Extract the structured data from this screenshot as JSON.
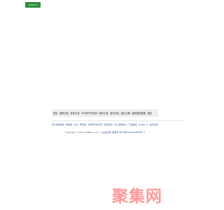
{
  "header": {
    "logo_text": "SkiBarns"
  },
  "nav": {
    "items": [
      "首页",
      "推荐出售",
      "新车出售",
      "中华网汽车资讯",
      "新车出售",
      "新车出售",
      "最近主题",
      "最新搭档搜集",
      "更多"
    ]
  },
  "links": {
    "items": [
      "导入其他域名 ",
      "精选站",
      "中心",
      "聚合站",
      "中华网汽车资讯",
      "聚合出售",
      "导入其他中心",
      "产品信息",
      "SkiBarns",
      "站点出售"
    ]
  },
  "footer": {
    "copyright": "Copyright © 2024 SkiBarns.com",
    "icp_label": "工业信息部",
    "icp_number": "备案号 京ICP备1000000000号 -1"
  },
  "watermark": {
    "text": "聚集网"
  }
}
